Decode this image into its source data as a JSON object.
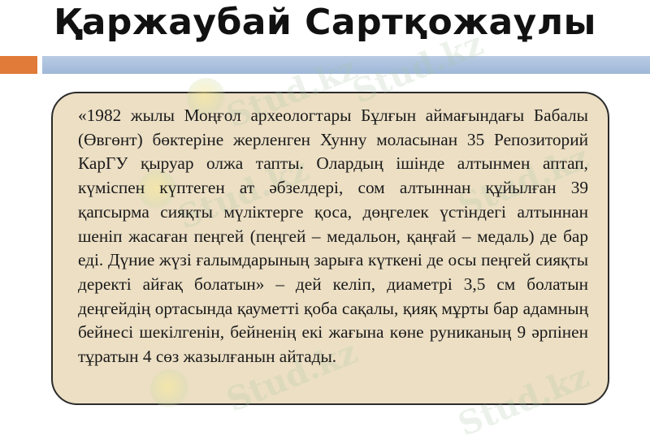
{
  "slide": {
    "title": "Қаржаубай Сартқожаұлы",
    "body": "«1982 жылы Моңғол археологтары Бұлғын аймағындағы Бабалы (Өвгөнт) бөктеріне жерленген Хунну моласынан 35 Репозиторий КарГУ қыруар олжа тапты. Олардың ішінде алтынмен аптап, күміспен күптеген ат әбзелдері, сом алтыннан құйылған 39 қапсырма сияқты мүліктерге қоса, дөңгелек үстіндегі алтыннан шеніп жасаған пеңгей (пеңгей – медальон, қаңғай – медаль) де бар еді. Дүние жүзі ғалымдарының зарыға күткені де осы пеңгей сияқты деректі айғақ болатын» – дей келіп, диаметрі 3,5 см болатын деңгейдің ортасында қауметті қоба сақалы, қияқ мұрты бар адамның бейнесі шекілгенін, бейненің екі жағына көне руниканың 9 әрпінен тұратын 4 сөз жазылғанын айтады."
  },
  "watermark": {
    "text": "Stud.kz"
  },
  "colors": {
    "accent_orange": "#e07b39",
    "accent_blue": "#a9c0de",
    "panel_fill": "#ecdfc4",
    "panel_border": "#2b2b2b"
  }
}
